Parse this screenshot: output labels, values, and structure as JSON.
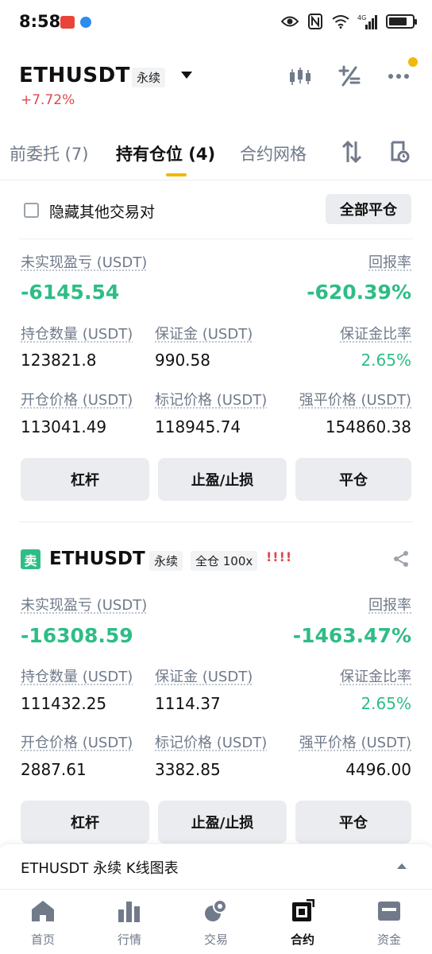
{
  "status_bar": {
    "time": "8:58",
    "network": "4G"
  },
  "header": {
    "pair": "ETHUSDT",
    "contract_type": "永续",
    "change": "+7.72%"
  },
  "tabs": {
    "open_orders": "前委托 (7)",
    "positions": "持有仓位 (4)",
    "grid": "合约网格"
  },
  "filter": {
    "hide_other_pairs": "隐藏其他交易对",
    "close_all": "全部平仓"
  },
  "positions": [
    {
      "pnl_label": "未实现盈亏 (USDT)",
      "pnl_value": "-6145.54",
      "roe_label": "回报率",
      "roe_value": "-620.39%",
      "size_label": "持仓数量 (USDT)",
      "size_value": "123821.8",
      "margin_label": "保证金 (USDT)",
      "margin_value": "990.58",
      "margin_ratio_label": "保证金比率",
      "margin_ratio_value": "2.65%",
      "entry_label": "开仓价格 (USDT)",
      "entry_value": "113041.49",
      "mark_label": "标记价格 (USDT)",
      "mark_value": "118945.74",
      "liq_label": "强平价格 (USDT)",
      "liq_value": "154860.38",
      "btn_leverage": "杠杆",
      "btn_tpsl": "止盈/止损",
      "btn_close": "平仓"
    },
    {
      "side": "卖",
      "pair": "ETHUSDT",
      "contract_type": "永续",
      "margin_mode": "全仓 100x",
      "warning": "!!!!",
      "pnl_label": "未实现盈亏 (USDT)",
      "pnl_value": "-16308.59",
      "roe_label": "回报率",
      "roe_value": "-1463.47%",
      "size_label": "持仓数量 (USDT)",
      "size_value": "111432.25",
      "margin_label": "保证金 (USDT)",
      "margin_value": "1114.37",
      "margin_ratio_label": "保证金比率",
      "margin_ratio_value": "2.65%",
      "entry_label": "开仓价格 (USDT)",
      "entry_value": "2887.61",
      "mark_label": "标记价格 (USDT)",
      "mark_value": "3382.85",
      "liq_label": "强平价格 (USDT)",
      "liq_value": "4496.00",
      "btn_leverage": "杠杆",
      "btn_tpsl": "止盈/止损",
      "btn_close": "平仓"
    }
  ],
  "kline_bar": {
    "text": "ETHUSDT 永续 K线图表"
  },
  "bottom_nav": [
    {
      "label": "首页",
      "icon": "home-icon"
    },
    {
      "label": "行情",
      "icon": "markets-icon"
    },
    {
      "label": "交易",
      "icon": "trade-icon"
    },
    {
      "label": "合约",
      "icon": "futures-icon",
      "active": true
    },
    {
      "label": "资金",
      "icon": "wallet-icon"
    }
  ],
  "colors": {
    "green": "#2ebd85",
    "red": "#e0484b",
    "accent": "#f0b90b",
    "gray": "#707a8a"
  }
}
